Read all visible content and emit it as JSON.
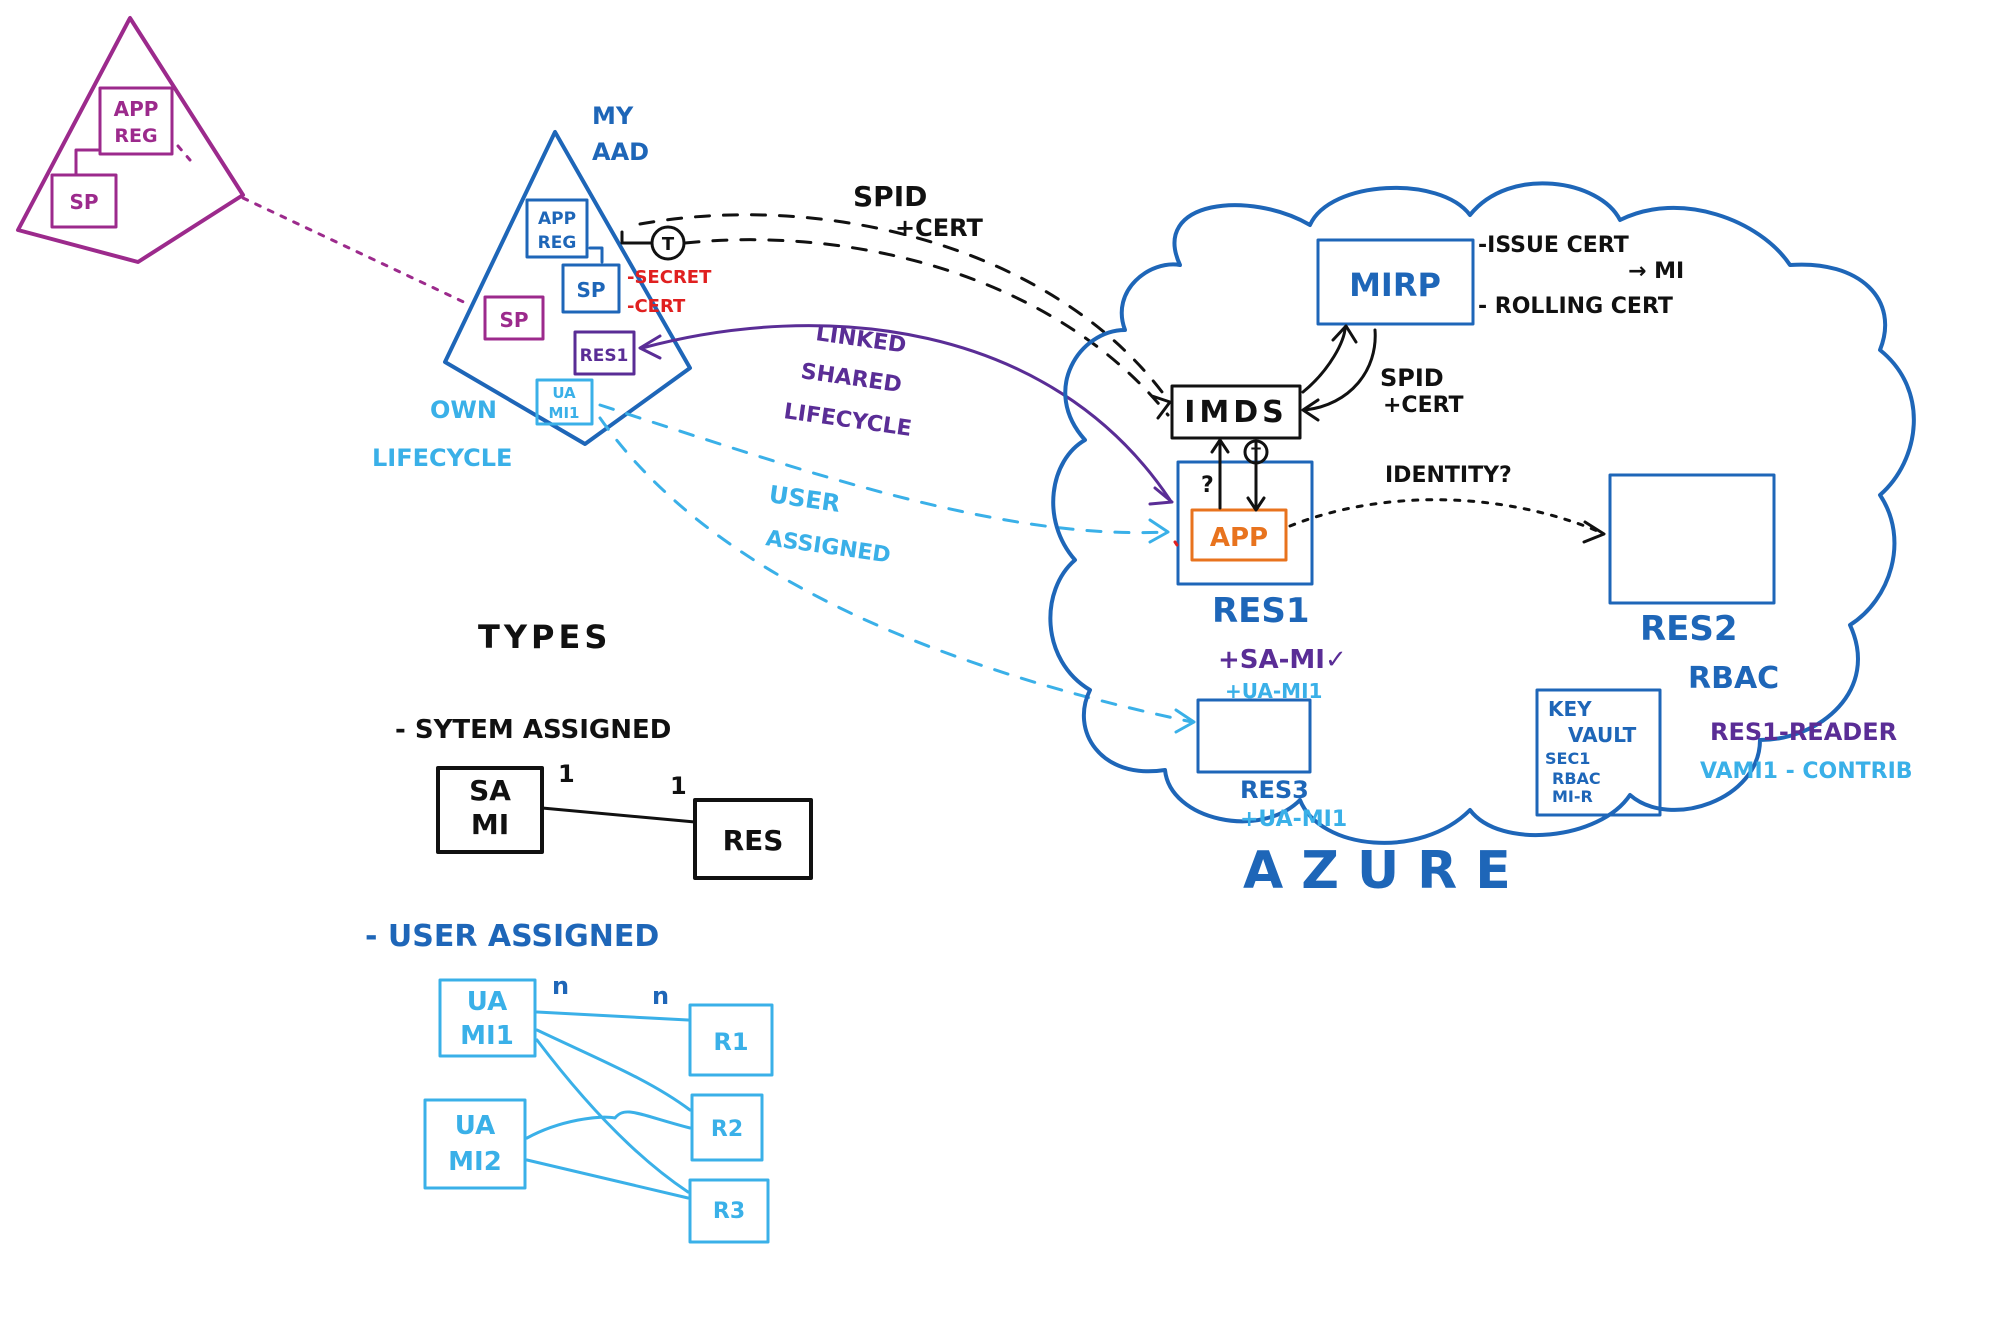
{
  "colors": {
    "magenta": "#9c2a8c",
    "blue": "#1e66b8",
    "purple": "#5a2d96",
    "cyan": "#3ab0e8",
    "red": "#e02020",
    "orange": "#e8731e",
    "black": "#111111"
  },
  "left_tenant": {
    "app_reg_line1": "APP",
    "app_reg_line2": "REG",
    "sp": "SP"
  },
  "my_aad": {
    "title_line1": "MY",
    "title_line2": "AAD",
    "app_reg_line1": "APP",
    "app_reg_line2": "REG",
    "sp": "SP",
    "secret": "-SECRET",
    "cert": "-CERT",
    "guest_sp": "SP",
    "res1": "RES1",
    "ua_mi_line1": "UA",
    "ua_mi_line2": "MI1",
    "own_line1": "OWN",
    "own_line2": "LIFECYCLE",
    "clock_label": "T"
  },
  "annotations": {
    "spid_line1": "SPID",
    "spid_line2": "+CERT",
    "linked_line1": "LINKED",
    "linked_line2": "SHARED",
    "linked_line3": "LIFECYCLE",
    "user_line1": "USER",
    "user_line2": "ASSIGNED"
  },
  "azure": {
    "label": "AZURE",
    "mirp": "MIRP",
    "issue_cert_line1": "-ISSUE CERT",
    "issue_cert_line2": "→ MI",
    "rolling_cert": "- ROLLING CERT",
    "spid_cert_line1": "SPID",
    "spid_cert_line2": "+CERT",
    "imds": "IMDS",
    "question": "?",
    "clock_label": "T",
    "app": "APP",
    "res1": "RES1",
    "sa_mi": "+SA-MI✓",
    "ua_mi": "+UA-MI1",
    "identity": "IDENTITY?",
    "res2": "RES2",
    "rbac": "RBAC",
    "res1_reader": "RES1-READER",
    "uami_contrib": "VAMI1 - CONTRIB",
    "res3": "RES3",
    "res3_ua": "+UA-MI1",
    "kv_line1": "KEY",
    "kv_line2": "VAULT",
    "kv_line3": "SEC1",
    "kv_line4": "RBAC",
    "kv_line5": "MI-R"
  },
  "types": {
    "title": "TYPES",
    "system_assigned": "- SYTEM ASSIGNED",
    "sa_mi_line1": "SA",
    "sa_mi_line2": "MI",
    "res": "RES",
    "card_left": "1",
    "card_right": "1",
    "user_assigned": "- USER ASSIGNED",
    "ua1_line1": "UA",
    "ua1_line2": "MI1",
    "ua2_line1": "UA",
    "ua2_line2": "MI2",
    "n_left": "n",
    "n_right": "n",
    "r1": "R1",
    "r2": "R2",
    "r3": "R3"
  }
}
